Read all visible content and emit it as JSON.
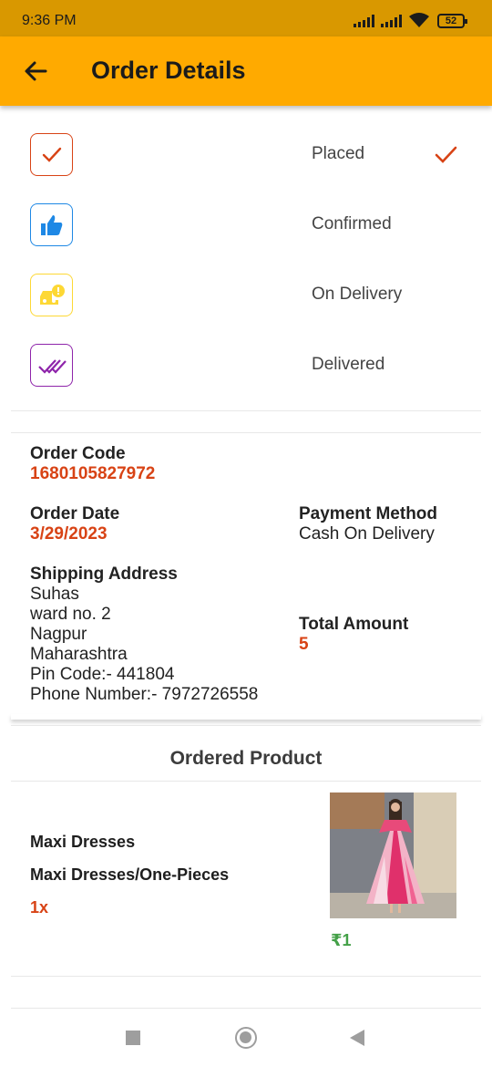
{
  "status_bar": {
    "time": "9:36 PM",
    "battery": "52"
  },
  "app_bar": {
    "title": "Order Details"
  },
  "steps": [
    {
      "label": "Placed",
      "icon": "check-icon",
      "color": "#d84315",
      "done": true
    },
    {
      "label": "Confirmed",
      "icon": "thumbs-up-icon",
      "color": "#1e88e5",
      "done": false
    },
    {
      "label": "On Delivery",
      "icon": "delivery-car-icon",
      "color": "#fdd835",
      "done": false
    },
    {
      "label": "Delivered",
      "icon": "double-check-icon",
      "color": "#8e24aa",
      "done": false
    }
  ],
  "order": {
    "code_label": "Order Code",
    "code": "1680105827972",
    "date_label": "Order Date",
    "date": "3/29/2023",
    "payment_label": "Payment Method",
    "payment": "Cash On Delivery",
    "shipping_label": "Shipping Address",
    "address": {
      "name": "Suhas",
      "line1": "ward no. 2",
      "city": "Nagpur",
      "state": "Maharashtra",
      "pin": "Pin Code:- 441804",
      "phone": "Phone Number:- 7972726558"
    },
    "total_label": "Total Amount",
    "total": "5"
  },
  "products_section": {
    "title": "Ordered Product",
    "items": [
      {
        "name": "Maxi Dresses",
        "category": "Maxi Dresses/One-Pieces",
        "qty": "1x",
        "price": "₹1",
        "image": "dress-photo"
      }
    ]
  },
  "colors": {
    "app_bar": "#ffaa00",
    "status_bar": "#d99800",
    "accent_red": "#d84315",
    "price_green": "#43a047"
  }
}
